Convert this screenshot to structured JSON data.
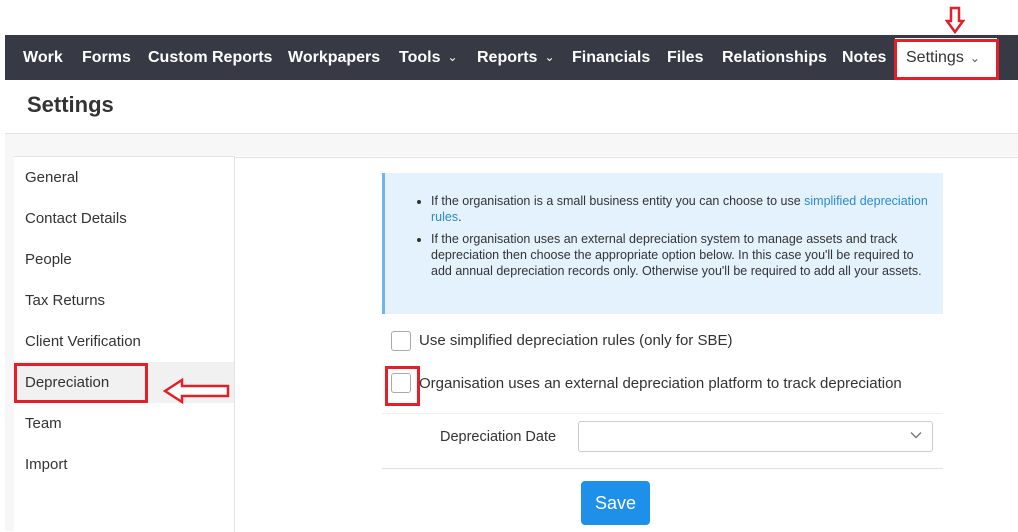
{
  "nav": {
    "items": [
      {
        "label": "Work"
      },
      {
        "label": "Forms"
      },
      {
        "label": "Custom Reports"
      },
      {
        "label": "Workpapers"
      },
      {
        "label": "Tools",
        "has_dropdown": true
      },
      {
        "label": "Reports",
        "has_dropdown": true
      },
      {
        "label": "Financials"
      },
      {
        "label": "Files"
      },
      {
        "label": "Relationships"
      },
      {
        "label": "Notes"
      }
    ],
    "active": {
      "label": "Settings",
      "has_dropdown": true
    },
    "background_color": "#373a44"
  },
  "page": {
    "title": "Settings"
  },
  "sidebar": {
    "items": [
      {
        "label": "General"
      },
      {
        "label": "Contact Details"
      },
      {
        "label": "People"
      },
      {
        "label": "Tax Returns"
      },
      {
        "label": "Client Verification"
      },
      {
        "label": "Depreciation",
        "active": true
      },
      {
        "label": "Team"
      },
      {
        "label": "Import"
      }
    ]
  },
  "info": {
    "bullet1_text": "If the organisation is a small business entity you can choose to use ",
    "bullet1_link": "simplified depreciation rules",
    "bullet1_end": ".",
    "bullet2_text": "If the organisation uses an external depreciation system to manage assets and track depreciation then choose the appropriate option below. In this case you'll be required to add annual depreciation records only. Otherwise you'll be required to add all your assets."
  },
  "form": {
    "simplified_label": "Use simplified depreciation rules (only for SBE)",
    "simplified_checked": false,
    "external_label": "Organisation uses an external depreciation platform to track depreciation",
    "external_checked": false,
    "date_label": "Depreciation Date",
    "date_value": "",
    "save_label": "Save"
  },
  "colors": {
    "annotation_red": "#e1202a",
    "save_button": "#1e90ea",
    "info_background": "#e3f2fd",
    "link": "#2a8ad2"
  }
}
